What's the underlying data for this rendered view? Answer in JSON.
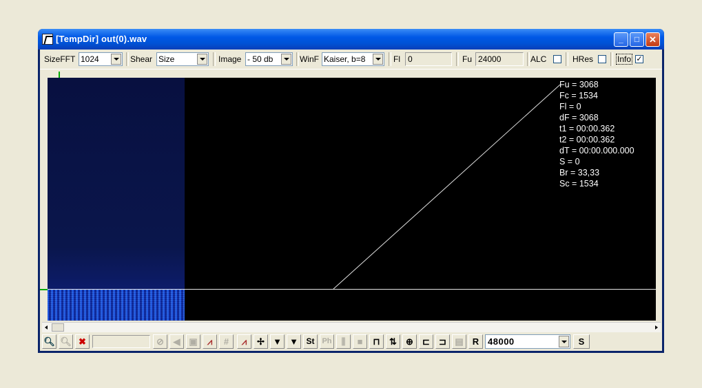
{
  "window": {
    "title": "[TempDir] out(0).wav"
  },
  "toolbar": {
    "sizefft": {
      "label": "SizeFFT",
      "value": "1024"
    },
    "shear": {
      "label": "Shear",
      "value": "Size"
    },
    "image": {
      "label": "Image",
      "value": "- 50 db"
    },
    "winf": {
      "label": "WinF",
      "value": "Kaiser, b=8"
    },
    "fl": {
      "label": "Fl",
      "value": "0"
    },
    "fu": {
      "label": "Fu",
      "value": "24000"
    },
    "alc": {
      "label": "ALC",
      "checked": false
    },
    "hres": {
      "label": "HRes",
      "checked": false
    },
    "info": {
      "label": "Info",
      "checked": true,
      "mark": "✓"
    }
  },
  "info_overlay": {
    "lines": [
      "Fu = 3068",
      "Fc = 1534",
      "Fl = 0",
      "dF = 3068",
      "t1 = 00:00.362",
      "t2 = 00:00.362",
      "dT = 00:00.000.000",
      "S = 0",
      "Br = 33,33",
      "Sc = 1534"
    ]
  },
  "bottombar": {
    "sc_glyph": "St",
    "ph_glyph": "Ph",
    "r_glyph": "R",
    "s_glyph": "S",
    "samplerate": "48000"
  },
  "colors": {
    "titlebar": "#0058E6",
    "canvas": "#000000",
    "spectrum": "#1535B0"
  }
}
